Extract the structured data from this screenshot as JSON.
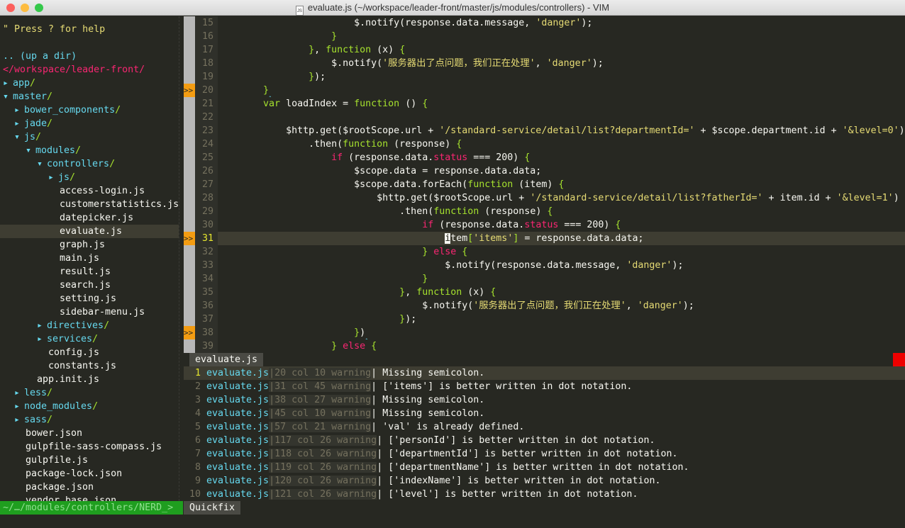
{
  "window": {
    "title": "evaluate.js (~/workspace/leader-front/master/js/modules/controllers) - VIM",
    "file_icon": "js-file-icon",
    "icon_label": "JS"
  },
  "tree": [
    {
      "text": "\" Press ? for help",
      "kind": "help",
      "depth": 0
    },
    {
      "text": "",
      "kind": "blank",
      "depth": 0
    },
    {
      "text": ".. (up a dir)",
      "kind": "up",
      "depth": 0
    },
    {
      "text": "</workspace/leader-front/",
      "kind": "root",
      "depth": 0
    },
    {
      "text": "app",
      "kind": "dir",
      "open": false,
      "depth": 0
    },
    {
      "text": "master",
      "kind": "dir",
      "open": true,
      "depth": 0
    },
    {
      "text": "bower_components",
      "kind": "dir",
      "open": false,
      "depth": 1
    },
    {
      "text": "jade",
      "kind": "dir",
      "open": false,
      "depth": 1
    },
    {
      "text": "js",
      "kind": "dir",
      "open": true,
      "depth": 1
    },
    {
      "text": "modules",
      "kind": "dir",
      "open": true,
      "depth": 2
    },
    {
      "text": "controllers",
      "kind": "dir",
      "open": true,
      "depth": 3
    },
    {
      "text": "js",
      "kind": "dir",
      "open": false,
      "depth": 4
    },
    {
      "text": "access-login.js",
      "kind": "file",
      "depth": 4
    },
    {
      "text": "customerstatistics.js",
      "kind": "file",
      "depth": 4
    },
    {
      "text": "datepicker.js",
      "kind": "file",
      "depth": 4
    },
    {
      "text": "evaluate.js",
      "kind": "file",
      "depth": 4,
      "selected": true
    },
    {
      "text": "graph.js",
      "kind": "file",
      "depth": 4
    },
    {
      "text": "main.js",
      "kind": "file",
      "depth": 4
    },
    {
      "text": "result.js",
      "kind": "file",
      "depth": 4
    },
    {
      "text": "search.js",
      "kind": "file",
      "depth": 4
    },
    {
      "text": "setting.js",
      "kind": "file",
      "depth": 4
    },
    {
      "text": "sidebar-menu.js",
      "kind": "file",
      "depth": 4
    },
    {
      "text": "directives",
      "kind": "dir",
      "open": false,
      "depth": 3
    },
    {
      "text": "services",
      "kind": "dir",
      "open": false,
      "depth": 3
    },
    {
      "text": "config.js",
      "kind": "file",
      "depth": 3
    },
    {
      "text": "constants.js",
      "kind": "file",
      "depth": 3
    },
    {
      "text": "app.init.js",
      "kind": "file",
      "depth": 2
    },
    {
      "text": "less",
      "kind": "dir",
      "open": false,
      "depth": 1
    },
    {
      "text": "node_modules",
      "kind": "dir",
      "open": false,
      "depth": 1
    },
    {
      "text": "sass",
      "kind": "dir",
      "open": false,
      "depth": 1
    },
    {
      "text": "bower.json",
      "kind": "file",
      "depth": 1
    },
    {
      "text": "gulpfile-sass-compass.js",
      "kind": "file",
      "depth": 1
    },
    {
      "text": "gulpfile.js",
      "kind": "file",
      "depth": 1
    },
    {
      "text": "package-lock.json",
      "kind": "file",
      "depth": 1
    },
    {
      "text": "package.json",
      "kind": "file",
      "depth": 1
    },
    {
      "text": "vendor.base.json",
      "kind": "file",
      "depth": 1
    }
  ],
  "editor": {
    "current_line": 31,
    "sign_text": ">>",
    "sign_lines": [
      20,
      31,
      38
    ],
    "lines": [
      {
        "n": 15,
        "t": [
          [
            "w",
            "                        $.notify(response.data.message, "
          ],
          [
            "s",
            "'danger'"
          ],
          [
            "w",
            ");"
          ]
        ]
      },
      {
        "n": 16,
        "t": [
          [
            "f",
            "                    }"
          ]
        ]
      },
      {
        "n": 17,
        "t": [
          [
            "f",
            "                }"
          ],
          [
            "w",
            ", "
          ],
          [
            "f",
            "function"
          ],
          [
            "w",
            " (x) "
          ],
          [
            "f",
            "{"
          ]
        ]
      },
      {
        "n": 18,
        "t": [
          [
            "w",
            "                    $.notify("
          ],
          [
            "s",
            "'服务器出了点问题，我们正在处理'"
          ],
          [
            "w",
            ", "
          ],
          [
            "s",
            "'danger'"
          ],
          [
            "w",
            ");"
          ]
        ]
      },
      {
        "n": 19,
        "t": [
          [
            "f",
            "                }"
          ],
          [
            "w",
            ");"
          ]
        ]
      },
      {
        "n": 20,
        "t": [
          [
            "f",
            "        }"
          ]
        ],
        "caret": true
      },
      {
        "n": 21,
        "t": [
          [
            "f",
            "        var"
          ],
          [
            "w",
            " loadIndex = "
          ],
          [
            "f",
            "function"
          ],
          [
            "w",
            " () "
          ],
          [
            "f",
            "{"
          ]
        ]
      },
      {
        "n": 22,
        "t": []
      },
      {
        "n": 23,
        "t": [
          [
            "w",
            "            $http.get($rootScope.url + "
          ],
          [
            "s",
            "'/standard-service/detail/list?departmentId='"
          ],
          [
            "w",
            " + $scope.department.id + "
          ],
          [
            "s",
            "'&level=0'"
          ],
          [
            "w",
            ")"
          ]
        ]
      },
      {
        "n": 24,
        "t": [
          [
            "w",
            "                .then("
          ],
          [
            "f",
            "function"
          ],
          [
            "w",
            " (response) "
          ],
          [
            "f",
            "{"
          ]
        ]
      },
      {
        "n": 25,
        "t": [
          [
            "k",
            "                    if"
          ],
          [
            "w",
            " (response.data."
          ],
          [
            "k",
            "status"
          ],
          [
            "w",
            " === 200) "
          ],
          [
            "f",
            "{"
          ]
        ]
      },
      {
        "n": 26,
        "t": [
          [
            "w",
            "                        $scope.data = response.data.data;"
          ]
        ]
      },
      {
        "n": 27,
        "t": [
          [
            "w",
            "                        $scope.data.forEach("
          ],
          [
            "f",
            "function"
          ],
          [
            "w",
            " (item) "
          ],
          [
            "f",
            "{"
          ]
        ]
      },
      {
        "n": 28,
        "t": [
          [
            "w",
            "                            $http.get($rootScope.url + "
          ],
          [
            "s",
            "'/standard-service/detail/list?fatherId='"
          ],
          [
            "w",
            " + item.id + "
          ],
          [
            "s",
            "'&level=1'"
          ],
          [
            "w",
            ")"
          ]
        ]
      },
      {
        "n": 29,
        "t": [
          [
            "w",
            "                                .then("
          ],
          [
            "f",
            "function"
          ],
          [
            "w",
            " (response) "
          ],
          [
            "f",
            "{"
          ]
        ]
      },
      {
        "n": 30,
        "t": [
          [
            "k",
            "                                    if"
          ],
          [
            "w",
            " (response.data."
          ],
          [
            "k",
            "status"
          ],
          [
            "w",
            " === 200) "
          ],
          [
            "f",
            "{"
          ]
        ]
      },
      {
        "n": 31,
        "t": [
          [
            "w",
            "                                        "
          ],
          [
            "cursor",
            "i"
          ],
          [
            "w",
            "tem"
          ],
          [
            "f",
            "["
          ],
          [
            "s",
            "'items'"
          ],
          [
            "f",
            "]"
          ],
          [
            "w",
            " = response.data.data;"
          ]
        ]
      },
      {
        "n": 32,
        "t": [
          [
            "f",
            "                                    }"
          ],
          [
            "k",
            " else "
          ],
          [
            "f",
            "{"
          ]
        ]
      },
      {
        "n": 33,
        "t": [
          [
            "w",
            "                                        $.notify(response.data.message, "
          ],
          [
            "s",
            "'danger'"
          ],
          [
            "w",
            ");"
          ]
        ]
      },
      {
        "n": 34,
        "t": [
          [
            "f",
            "                                    }"
          ]
        ]
      },
      {
        "n": 35,
        "t": [
          [
            "f",
            "                                }"
          ],
          [
            "w",
            ", "
          ],
          [
            "f",
            "function"
          ],
          [
            "w",
            " (x) "
          ],
          [
            "f",
            "{"
          ]
        ]
      },
      {
        "n": 36,
        "t": [
          [
            "w",
            "                                    $.notify("
          ],
          [
            "s",
            "'服务器出了点问题，我们正在处理'"
          ],
          [
            "w",
            ", "
          ],
          [
            "s",
            "'danger'"
          ],
          [
            "w",
            ");"
          ]
        ]
      },
      {
        "n": 37,
        "t": [
          [
            "f",
            "                                }"
          ],
          [
            "w",
            ");"
          ]
        ]
      },
      {
        "n": 38,
        "t": [
          [
            "f",
            "                        }"
          ],
          [
            "w",
            ")"
          ]
        ],
        "caret": true
      },
      {
        "n": 39,
        "t": [
          [
            "f",
            "                    }"
          ],
          [
            "k",
            " else "
          ],
          [
            "f",
            "{"
          ]
        ]
      }
    ]
  },
  "quickfix": {
    "tab_label": "evaluate.js",
    "rows": [
      {
        "n": "1",
        "file": "evaluate.js",
        "loc": "20 col 10 warning",
        "msg": " Missing semicolon."
      },
      {
        "n": "2",
        "file": "evaluate.js",
        "loc": "31 col 45 warning",
        "msg": " ['items'] is better written in dot notation."
      },
      {
        "n": "3",
        "file": "evaluate.js",
        "loc": "38 col 27 warning",
        "msg": " Missing semicolon."
      },
      {
        "n": "4",
        "file": "evaluate.js",
        "loc": "45 col 10 warning",
        "msg": " Missing semicolon."
      },
      {
        "n": "5",
        "file": "evaluate.js",
        "loc": "57 col 21 warning",
        "msg": " 'val' is already defined."
      },
      {
        "n": "6",
        "file": "evaluate.js",
        "loc": "117 col 26 warning",
        "msg": " ['personId'] is better written in dot notation."
      },
      {
        "n": "7",
        "file": "evaluate.js",
        "loc": "118 col 26 warning",
        "msg": " ['departmentId'] is better written in dot notation."
      },
      {
        "n": "8",
        "file": "evaluate.js",
        "loc": "119 col 26 warning",
        "msg": " ['departmentName'] is better written in dot notation."
      },
      {
        "n": "9",
        "file": "evaluate.js",
        "loc": "120 col 26 warning",
        "msg": " ['indexName'] is better written in dot notation."
      },
      {
        "n": "10",
        "file": "evaluate.js",
        "loc": "121 col 26 warning",
        "msg": " ['level'] is better written in dot notation."
      }
    ]
  },
  "statusline": {
    "nerd": "~/…/modules/controllers/NERD_>",
    "quickfix": "Quickfix",
    "nerd_color": "#1f9e1f",
    "error_color": "#e00000"
  }
}
